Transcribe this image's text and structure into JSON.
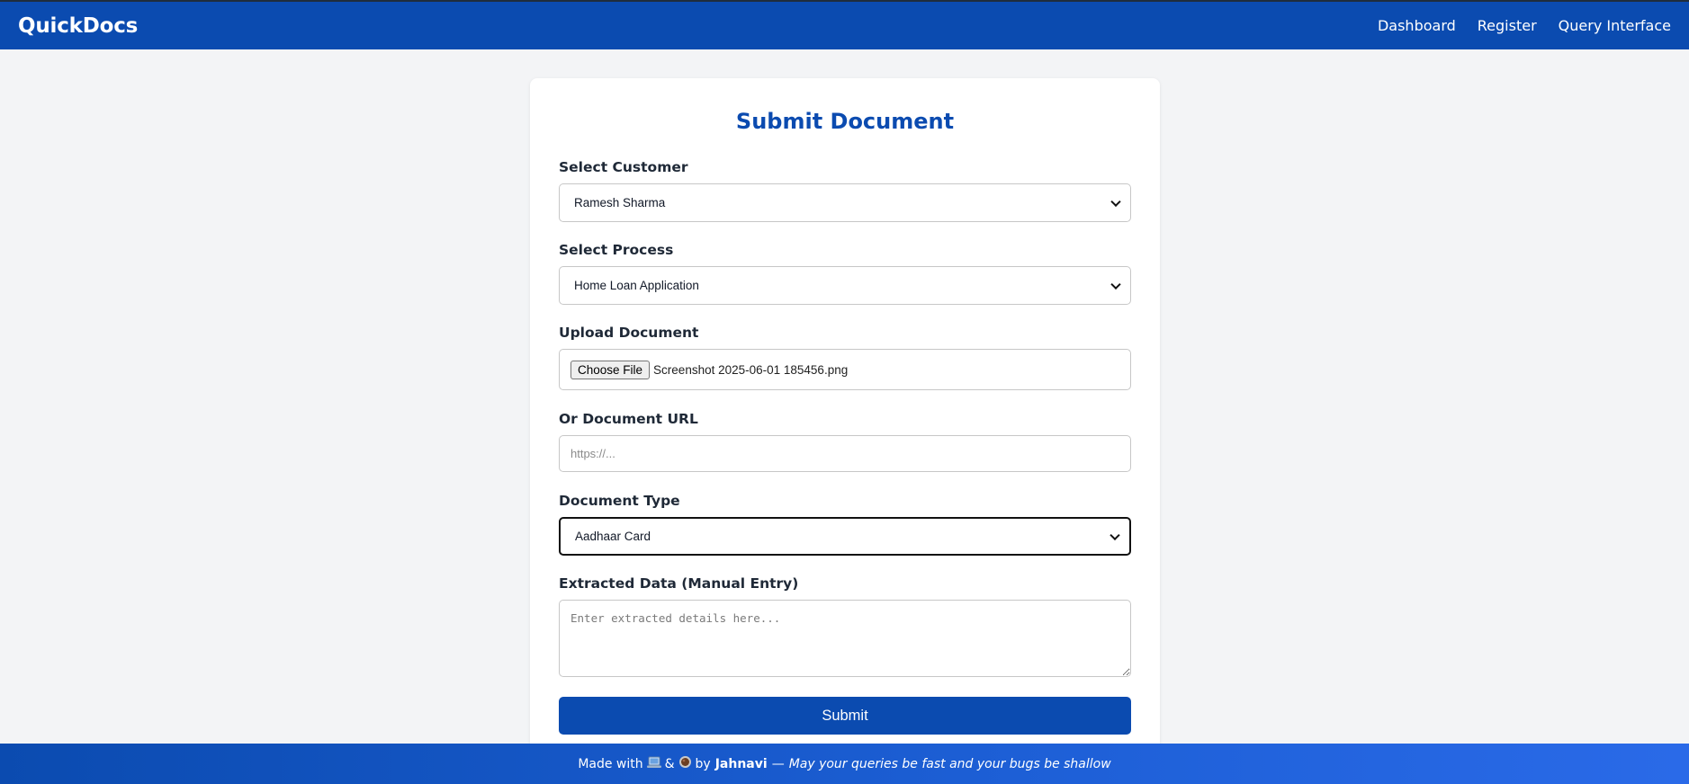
{
  "header": {
    "brand": "QuickDocs",
    "nav": [
      "Dashboard",
      "Register",
      "Query Interface"
    ]
  },
  "form": {
    "title": "Submit Document",
    "customer": {
      "label": "Select Customer",
      "value": "Ramesh Sharma"
    },
    "process": {
      "label": "Select Process",
      "value": "Home Loan Application"
    },
    "upload": {
      "label": "Upload Document",
      "button": "Choose File",
      "filename": "Screenshot 2025-06-01 185456.png"
    },
    "url": {
      "label": "Or Document URL",
      "placeholder": "https://..."
    },
    "doc_type": {
      "label": "Document Type",
      "value": "Aadhaar Card"
    },
    "extracted": {
      "label": "Extracted Data (Manual Entry)",
      "placeholder": "Enter extracted details here..."
    },
    "submit": "Submit"
  },
  "footer": {
    "made_with": "Made with",
    "amp": "&",
    "by": "by",
    "author": "Jahnavi",
    "dash": "—",
    "tagline": "May your queries be fast and your bugs be shallow",
    "icons": [
      "laptop-icon",
      "coffee-icon"
    ]
  },
  "colors": {
    "primary": "#0b4bb0",
    "background": "#f3f4f6",
    "card": "#ffffff"
  }
}
